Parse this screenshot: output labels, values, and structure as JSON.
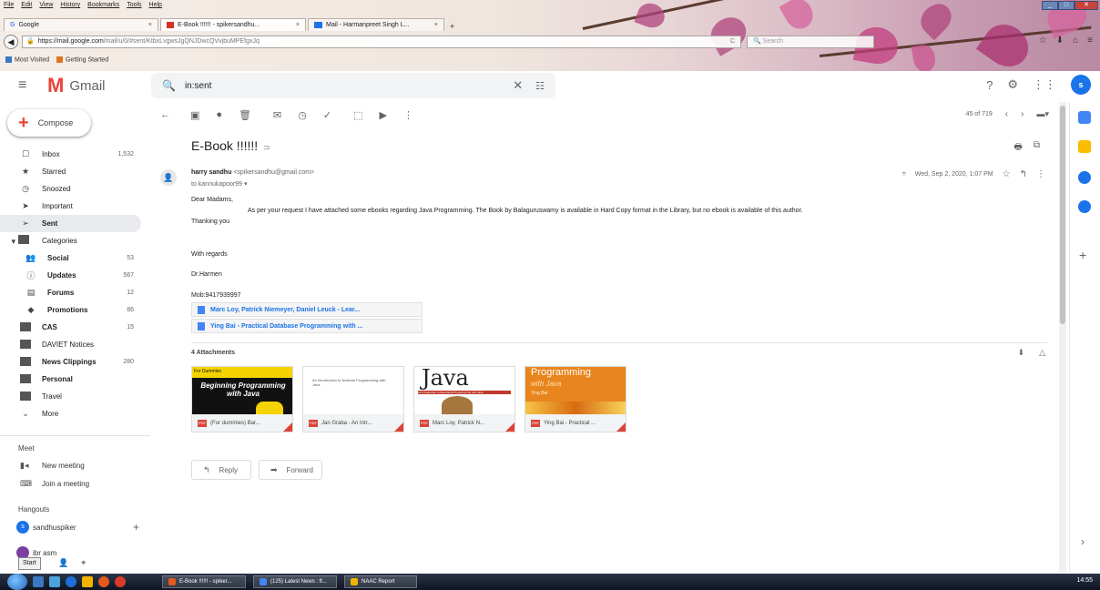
{
  "browser": {
    "menu": [
      "File",
      "Edit",
      "View",
      "History",
      "Bookmarks",
      "Tools",
      "Help"
    ],
    "tabs": [
      {
        "label": "Google",
        "close": "×"
      },
      {
        "label": "E-Book !!!!!! - spikersandhu...",
        "close": "×"
      },
      {
        "label": "Mail - Harmanpreet Singh L...",
        "close": "×"
      }
    ],
    "new_tab": "+",
    "url_host": "https://mail.google.com",
    "url_path": "/mail/u/0/#sent/KtbxLvgwsJgQNJDwcQVvjbuMPEfgxJq",
    "search_placeholder": "Search",
    "bookmarks": [
      "Most Visited",
      "Getting Started"
    ]
  },
  "gmail": {
    "logo_text": "Gmail",
    "search_value": "in:sent",
    "avatar": "s"
  },
  "compose_label": "Compose",
  "nav": [
    {
      "icon": "☐",
      "label": "Inbox",
      "count": "1,532"
    },
    {
      "icon": "★",
      "label": "Starred",
      "count": ""
    },
    {
      "icon": "◷",
      "label": "Snoozed",
      "count": ""
    },
    {
      "icon": "➤",
      "label": "Important",
      "count": ""
    },
    {
      "icon": "➢",
      "label": "Sent",
      "count": ""
    },
    {
      "icon": "▾",
      "label": "Categories",
      "count": ""
    },
    {
      "icon": "👥",
      "label": "Social",
      "count": "53"
    },
    {
      "icon": "ⓘ",
      "label": "Updates",
      "count": "567"
    },
    {
      "icon": "▤",
      "label": "Forums",
      "count": "12"
    },
    {
      "icon": "◆",
      "label": "Promotions",
      "count": "86"
    },
    {
      "icon": "■",
      "label": "CAS",
      "count": "15"
    },
    {
      "icon": "■",
      "label": "DAVIET Notices",
      "count": ""
    },
    {
      "icon": "■",
      "label": "News Clippings",
      "count": "280"
    },
    {
      "icon": "■",
      "label": "Personal",
      "count": ""
    },
    {
      "icon": "■",
      "label": "Travel",
      "count": ""
    },
    {
      "icon": "⌄",
      "label": "More",
      "count": ""
    }
  ],
  "meet": {
    "heading": "Meet",
    "new_meeting": "New meeting",
    "join": "Join a meeting"
  },
  "hangouts": {
    "heading": "Hangouts",
    "user1": "sandhuspiker",
    "user2": "ibr asm",
    "plus": "+"
  },
  "toolbar": {
    "pagination": "45 of 719"
  },
  "message": {
    "subject": "E-Book !!!!!!",
    "sender_name": "harry sandhu",
    "sender_email": "<spikersandhu@gmail.com>",
    "to": "to kannukapoor99",
    "date": "Wed, Sep 2, 2020, 1:07 PM",
    "salutation": "Dear Madams,",
    "para": "As per your request I have attached some ebooks regarding Java Programming. The Book by Balaguruswamy is available in Hard Copy format in the Library, but no ebook is available of this author.",
    "thanks": "Thanking you",
    "regards": "With regards",
    "name": "Dr.Harmen",
    "mob": "Mob:9417939997",
    "links": [
      "Marc Loy, Patrick Niemeyer, Daniel Leuck - Lear...",
      "Ying Bai - Practical Database Programming with ..."
    ],
    "attachments_heading": "4 Attachments",
    "attachments": [
      {
        "name": "(For dummies) Bar...",
        "thumb_text": "Beginning Programming with Java",
        "thumb_badge": "For Dummies"
      },
      {
        "name": "Jan Graba - An Intr...",
        "thumb_text": "An Introduction to Network Programming with Java"
      },
      {
        "name": "Marc Loy, Patrick N...",
        "thumb_text": "Java",
        "thumb_sub": "An Introduction to Real-World Programming with Java"
      },
      {
        "name": "Ying Bai - Practical ...",
        "thumb_text": "Programming",
        "thumb_sub": "with Java",
        "thumb_author": "Ying Bai"
      }
    ],
    "reply": "Reply",
    "forward": "Forward"
  },
  "taskbar": {
    "start": "Start",
    "tasks": [
      "E-Book !!!!!! - spiker...",
      "(125) Latest News : fl...",
      "NAAC Report"
    ],
    "clock": "14:55"
  }
}
